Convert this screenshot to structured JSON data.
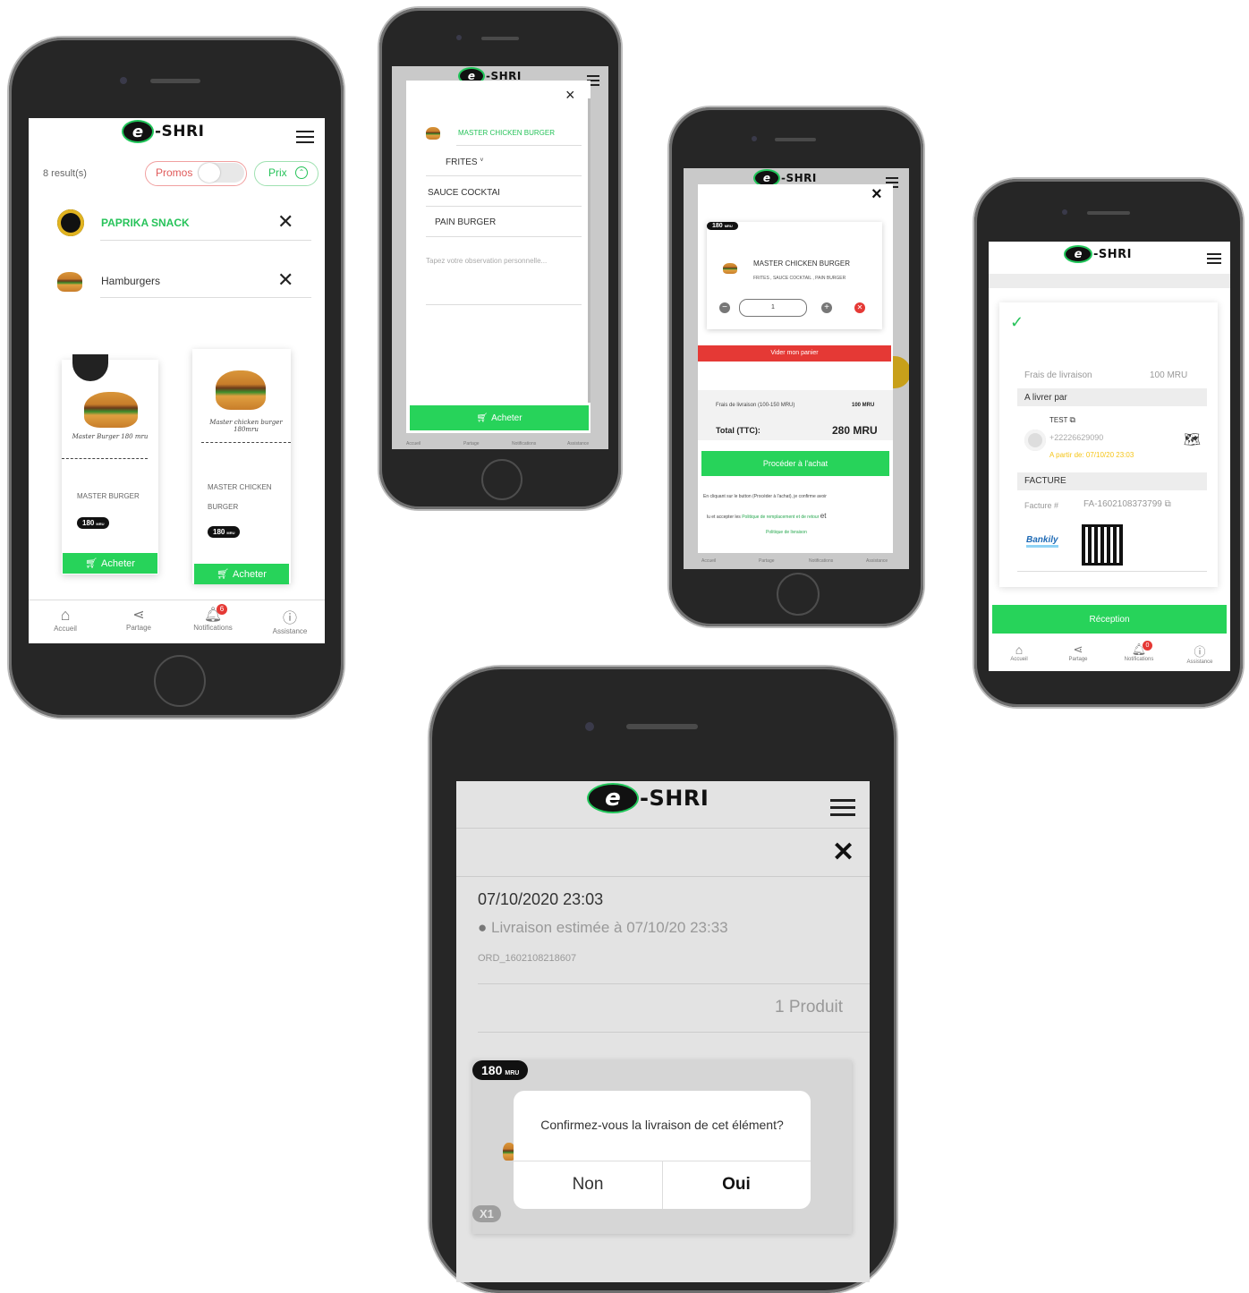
{
  "brand": {
    "e": "e",
    "text": "-SHRI"
  },
  "nav": [
    {
      "label": "Accueil"
    },
    {
      "label": "Partage"
    },
    {
      "label": "Notifications",
      "badge": "6"
    },
    {
      "label": "Assistance"
    }
  ],
  "nav4_badge": "0",
  "screen1": {
    "results": "8 result(s)",
    "promos_label": "Promos",
    "prix_label": "Prix",
    "restaurant": "PAPRIKA SNACK",
    "category": "Hamburgers",
    "products": [
      {
        "pic_label": "Master Burger 180 mru",
        "name": "MASTER BURGER",
        "price": "180",
        "unit": "MRU",
        "buy": "Acheter"
      },
      {
        "pic_label": "Master chicken burger 180mru",
        "name": "MASTER CHICKEN BURGER",
        "price": "180",
        "unit": "MRU",
        "buy": "Acheter"
      }
    ]
  },
  "screen2": {
    "product": "MASTER CHICKEN BURGER",
    "options": [
      "FRITES",
      "SAUCE COCKTAI",
      "PAIN BURGER"
    ],
    "observation_placeholder": "Tapez votre observation personnelle...",
    "buy": "Acheter",
    "close": "×"
  },
  "screen3": {
    "price_badge": "180",
    "price_unit": "MRU",
    "product": "MASTER CHICKEN BURGER",
    "extras": "FRITES , SAUCE COCKTAIL , PAIN BURGER",
    "qty": "1",
    "empty_cart": "Vider mon panier",
    "fees_label": "Frais de livraison (100-150 MRU)",
    "fees_value": "100 MRU",
    "total_label": "Total (TTC):",
    "total_value": "280 MRU",
    "proceed": "Procéder à l'achat",
    "legal_1": "En cliquant sur le button (Procéder à l'achat), je confirme avoir",
    "legal_2_a": "lu et accepter les",
    "legal_2_link": "Politique de remplacement et de retour",
    "legal_2_b": "et",
    "legal_3_link": "Politique de livraison",
    "close": "×"
  },
  "screen4": {
    "fees_label": "Frais de livraison",
    "fees_value": "100 MRU",
    "deliver_by": "A livrer par",
    "courier_name": "TEST",
    "courier_phone": "+22226629090",
    "from_date": "A partir de: 07/10/20 23:03",
    "invoice_header": "FACTURE",
    "invoice_label": "Facture #",
    "invoice_no": "FA-1602108373799",
    "bankily": "Bankily",
    "reception": "Réception"
  },
  "screen5": {
    "date": "07/10/2020 23:03",
    "estimate": "Livraison estimée à 07/10/20 23:33",
    "order_id": "ORD_1602108218607",
    "products_count": "1 Produit",
    "price_badge": "180",
    "price_unit": "MRU",
    "qty_badge": "X1",
    "dialog_text": "Confirmez-vous la livraison de cet élément?",
    "no": "Non",
    "yes": "Oui"
  },
  "colors": {
    "green": "#27d35a",
    "red": "#e53935",
    "dark": "#262626",
    "amber": "#f5c518"
  }
}
